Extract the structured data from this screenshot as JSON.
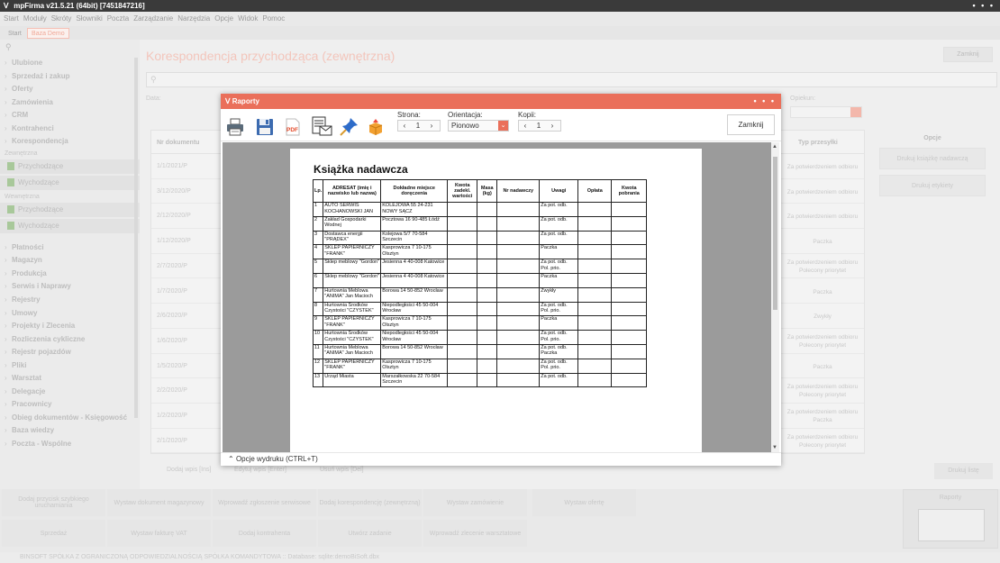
{
  "window": {
    "title": "mpFirma v21.5.21 (64bit) [7451847216]",
    "dots": "• • •"
  },
  "menu": [
    "Start",
    "Moduły",
    "Skróty",
    "Słowniki",
    "Poczta",
    "Zarządzanie",
    "Narzędzia",
    "Opcje",
    "Widok",
    "Pomoc"
  ],
  "tabs": {
    "start": "Start",
    "active": "Baza Demo"
  },
  "sidebar": {
    "search_icon": "search-icon",
    "items_top": [
      "Ulubione",
      "Sprzedaż i zakup",
      "Oferty",
      "Zamówienia",
      "CRM",
      "Kontrahenci",
      "Korespondencja"
    ],
    "group_incoming": "Zewnętrzna",
    "group_internal": "Wewnętrzna",
    "sub_incoming": [
      "Przychodzące",
      "Wychodzące"
    ],
    "sub_internal": [
      "Przychodzące",
      "Wychodzące"
    ],
    "items_bottom": [
      "Płatności",
      "Magazyn",
      "Produkcja",
      "Serwis i Naprawy",
      "Rejestry",
      "Umowy",
      "Projekty i Zlecenia",
      "Rozliczenia cykliczne",
      "Rejestr pojazdów",
      "Pliki",
      "Warsztat",
      "Delegacje",
      "Pracownicy",
      "Obieg dokumentów - Księgowość",
      "Baza wiedzy",
      "Poczta - Wspólne"
    ]
  },
  "main": {
    "title": "Korespondencja przychodząca (zewnętrzna)",
    "close_label": "Zamknij",
    "data_label": "Data:",
    "opiekun_label": "Opiekun:",
    "col_nr": "Nr dokumentu",
    "col_typ": "Typ przesyłki",
    "rows": [
      {
        "nr": "1/1/2021/P",
        "typ": "Za potwierdzeniem odbioru"
      },
      {
        "nr": "3/12/2020/P",
        "typ": "Za potwierdzeniem odbioru"
      },
      {
        "nr": "2/12/2020/P",
        "typ": "Za potwierdzeniem odbioru"
      },
      {
        "nr": "1/12/2020/P",
        "typ": "Paczka"
      },
      {
        "nr": "2/7/2020/P",
        "typ": "Za potwierdzeniem odbioru Polecony priorytet"
      },
      {
        "nr": "1/7/2020/P",
        "typ": "Paczka"
      },
      {
        "nr": "2/6/2020/P",
        "typ": "Zwykły"
      },
      {
        "nr": "1/6/2020/P",
        "typ": "Za potwierdzeniem odbioru Polecony priorytet"
      },
      {
        "nr": "1/5/2020/P",
        "typ": "Paczka"
      },
      {
        "nr": "2/2/2020/P",
        "typ": "Za potwierdzeniem odbioru Polecony priorytet"
      },
      {
        "nr": "1/2/2020/P",
        "typ": "Za potwierdzeniem odbioru Paczka"
      },
      {
        "nr": "2/1/2020/P",
        "typ": "Za potwierdzeniem odbioru Polecony priorytet"
      }
    ],
    "opcje_title": "Opcje",
    "opcje_buttons": [
      "Drukuj książkę nadawczą",
      "Drukuj etykiety"
    ],
    "bottom_buttons": [
      "Dodaj wpis [Ins]",
      "Edytuj wpis [Enter]",
      "Usuń wpis [Del]"
    ],
    "drukuj_liste": "Drukuj listę"
  },
  "quick_actions": {
    "row1": [
      "Dodaj przycisk szybkiego uruchamiania",
      "Wystaw dokument magazynowy",
      "Wprowadź zgłoszenie serwisowe",
      "Dodaj korespondencję (zewnętrzną)",
      "Wystaw zamówienie",
      "Wystaw ofertę"
    ],
    "row2": [
      "Sprzedaż",
      "Wystaw fakturę VAT",
      "Dodaj kontrahenta",
      "Utwórz zadanie",
      "Wprowadź zlecenie warsztatowe"
    ],
    "raporty": "Raporty"
  },
  "status": "BINSOFT SPÓŁKA Z OGRANICZONĄ ODPOWIEDZIALNOŚCIĄ SPÓŁKA KOMANDYTOWA :: Database: sqlite:demoBiSoft.dbx",
  "modal": {
    "title": "Raporty",
    "dots": "• • •",
    "strona_label": "Strona:",
    "strona_value": "1",
    "orientacja_label": "Orientacja:",
    "orientacja_value": "Pionowo",
    "kopii_label": "Kopii:",
    "kopii_value": "1",
    "close_label": "Zamknij",
    "opcje_wydruku": "Opcje wydruku (CTRL+T)",
    "pdf_label": "PDF",
    "accent": "#ea6f5a"
  },
  "report": {
    "title": "Książka nadawcza",
    "columns": [
      "Lp.",
      "ADRESAT (imię i nazwisko lub nazwa)",
      "Dokładne miejsce doręczenia",
      "Kwota zadekl. wartości",
      "Masa (kg)",
      "Nr nadawczy",
      "Uwagi",
      "Opłata",
      "Kwota pobrania"
    ],
    "rows": [
      [
        "1",
        "AUTO SERWIS KOCHANOWSKI JAN",
        "KOLEJOWA 55 24-231 NOWY SĄCZ",
        "",
        "",
        "",
        "Za pot. odb.",
        "",
        ""
      ],
      [
        "2",
        "Zakład Gospodarki Wodnej",
        "Pocztowa 16 90-485 Łódź",
        "",
        "",
        "",
        "Za pot. odb.",
        "",
        ""
      ],
      [
        "3",
        "Dostawca energii \"PRĄDEX\"",
        "Kolejowa 5/7 70-584 Szczecin",
        "",
        "",
        "",
        "Za pot. odb.",
        "",
        ""
      ],
      [
        "4",
        "SKLEP PAPIERNICZY \"FRANK\"",
        "Kasprowicza 7 10-175 Olsztyn",
        "",
        "",
        "",
        "Paczka",
        "",
        ""
      ],
      [
        "5",
        "Sklep meblowy \"Gordon\"",
        "Jesienna 4 40-008 Katowice",
        "",
        "",
        "",
        "Za pot. odb. Pol. prio.",
        "",
        ""
      ],
      [
        "6",
        "Sklep meblowy \"Gordon\"",
        "Jesienna 4 40-008 Katowice",
        "",
        "",
        "",
        "Paczka",
        "",
        ""
      ],
      [
        "7",
        "Hurtownia Meblowa \"ANIMA\" Jan Macioch",
        "Borowa 14 50-852 Wrocław",
        "",
        "",
        "",
        "Zwykły",
        "",
        ""
      ],
      [
        "8",
        "Hurtownia Środków Czystości \"CZYSTEK\"",
        "Niepodległości 45 50-004 Wrocław",
        "",
        "",
        "",
        "Za pot. odb. Pol. prio.",
        "",
        ""
      ],
      [
        "9",
        "SKLEP PAPIERNICZY \"FRANK\"",
        "Kasprowicza 7 10-175 Olsztyn",
        "",
        "",
        "",
        "Paczka",
        "",
        ""
      ],
      [
        "10",
        "Hurtownia Środków Czystości \"CZYSTEK\"",
        "Niepodległości 45 50-004 Wrocław",
        "",
        "",
        "",
        "Za pot. odb. Pol. prio.",
        "",
        ""
      ],
      [
        "11",
        "Hurtownia Meblowa \"ANIMA\" Jan Macioch",
        "Borowa 14 50-852 Wrocław",
        "",
        "",
        "",
        "Za pot. odb. Paczka",
        "",
        ""
      ],
      [
        "12",
        "SKLEP PAPIERNICZY \"FRANK\"",
        "Kasprowicza 7 10-175 Olsztyn",
        "",
        "",
        "",
        "Za pot. odb. Pol. prio.",
        "",
        ""
      ],
      [
        "13",
        "Urząd Miasta",
        "Marszałkowska 22 70-584 Szczecin",
        "",
        "",
        "",
        "Za pot. odb.",
        "",
        ""
      ]
    ]
  }
}
